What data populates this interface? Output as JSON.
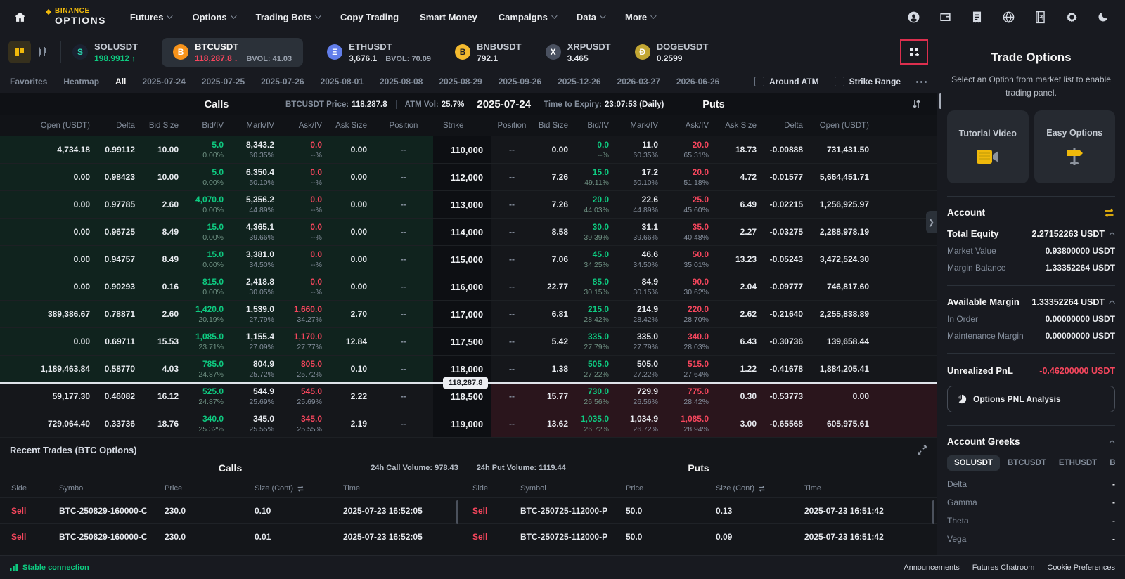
{
  "topnav": {
    "brand_line1": "BINANCE",
    "brand_line2": "OPTIONS",
    "items": [
      {
        "label": "Futures",
        "caret": true
      },
      {
        "label": "Options",
        "caret": true
      },
      {
        "label": "Trading Bots",
        "caret": true
      },
      {
        "label": "Copy Trading",
        "caret": false
      },
      {
        "label": "Smart Money",
        "caret": false
      },
      {
        "label": "Campaigns",
        "caret": true
      },
      {
        "label": "Data",
        "caret": true
      },
      {
        "label": "More",
        "caret": true
      }
    ]
  },
  "ticker_bar": {
    "tickers": [
      {
        "symbol": "SOLUSDT",
        "price": "198.9912",
        "dir": "up",
        "bvol": "",
        "icon_char": "S",
        "icon_bg": "#1b2130",
        "icon_color": "#2bd9b1",
        "selected": false
      },
      {
        "symbol": "BTCUSDT",
        "price": "118,287.8",
        "dir": "down",
        "bvol": "BVOL: 41.03",
        "icon_char": "B",
        "icon_bg": "#f7931a",
        "icon_color": "#ffffff",
        "selected": true
      },
      {
        "symbol": "ETHUSDT",
        "price": "3,676.1",
        "dir": "",
        "bvol": "BVOL: 70.09",
        "icon_char": "Ξ",
        "icon_bg": "#627eea",
        "icon_color": "#ffffff",
        "selected": false
      },
      {
        "symbol": "BNBUSDT",
        "price": "792.1",
        "dir": "",
        "bvol": "",
        "icon_char": "B",
        "icon_bg": "#f3ba2f",
        "icon_color": "#1e2026",
        "selected": false
      },
      {
        "symbol": "XRPUSDT",
        "price": "3.465",
        "dir": "",
        "bvol": "",
        "icon_char": "X",
        "icon_bg": "#4a5160",
        "icon_color": "#ffffff",
        "selected": false
      },
      {
        "symbol": "DOGEUSDT",
        "price": "0.2599",
        "dir": "",
        "bvol": "",
        "icon_char": "Ð",
        "icon_bg": "#c2a633",
        "icon_color": "#ffffff",
        "selected": false
      }
    ]
  },
  "filter_bar": {
    "tabs": [
      {
        "label": "Favorites",
        "active": false
      },
      {
        "label": "Heatmap",
        "active": false
      },
      {
        "label": "All",
        "active": true
      },
      {
        "label": "2025-07-24",
        "active": false
      },
      {
        "label": "2025-07-25",
        "active": false
      },
      {
        "label": "2025-07-26",
        "active": false
      },
      {
        "label": "2025-08-01",
        "active": false
      },
      {
        "label": "2025-08-08",
        "active": false
      },
      {
        "label": "2025-08-29",
        "active": false
      },
      {
        "label": "2025-09-26",
        "active": false
      },
      {
        "label": "2025-12-26",
        "active": false
      },
      {
        "label": "2026-03-27",
        "active": false
      },
      {
        "label": "2026-06-26",
        "active": false
      }
    ],
    "around_atm": "Around ATM",
    "strike_range": "Strike Range"
  },
  "chain": {
    "calls_title": "Calls",
    "puts_title": "Puts",
    "price_label": "BTCUSDT Price:",
    "price_value": "118,287.8",
    "atm_vol_label": "ATM Vol:",
    "atm_vol_value": "25.7%",
    "date": "2025-07-24",
    "expiry_label": "Time to Expiry:",
    "expiry_value": "23:07:53 (Daily)",
    "call_headers": [
      "Open (USDT)",
      "Delta",
      "Bid Size",
      "Bid/IV",
      "Mark/IV",
      "Ask/IV",
      "Ask Size",
      "Position"
    ],
    "strike_header": "Strike",
    "put_headers": [
      "Position",
      "Bid Size",
      "Bid/IV",
      "Mark/IV",
      "Ask/IV",
      "Ask Size",
      "Delta",
      "Open (USDT)"
    ],
    "price_tag": "118,287.8",
    "price_line_row": 9,
    "rows": [
      {
        "strike": "110,000",
        "call": {
          "open": "4,734.18",
          "delta": "0.99112",
          "bid_size": "10.00",
          "bid": "5.0",
          "bid_iv": "0.00%",
          "mark": "8,343.2",
          "mark_iv": "60.35%",
          "ask": "0.0",
          "ask_iv": "--%",
          "ask_size": "0.00",
          "position": "--",
          "itm": true
        },
        "put": {
          "position": "--",
          "bid_size": "0.00",
          "bid": "0.0",
          "bid_iv": "--%",
          "mark": "11.0",
          "mark_iv": "60.35%",
          "ask": "20.0",
          "ask_iv": "65.31%",
          "ask_size": "18.73",
          "delta": "-0.00888",
          "open": "731,431.50",
          "itm": false
        }
      },
      {
        "strike": "112,000",
        "call": {
          "open": "0.00",
          "delta": "0.98423",
          "bid_size": "10.00",
          "bid": "5.0",
          "bid_iv": "0.00%",
          "mark": "6,350.4",
          "mark_iv": "50.10%",
          "ask": "0.0",
          "ask_iv": "--%",
          "ask_size": "0.00",
          "position": "--",
          "itm": true
        },
        "put": {
          "position": "--",
          "bid_size": "7.26",
          "bid": "15.0",
          "bid_iv": "49.11%",
          "mark": "17.2",
          "mark_iv": "50.10%",
          "ask": "20.0",
          "ask_iv": "51.18%",
          "ask_size": "4.72",
          "delta": "-0.01577",
          "open": "5,664,451.71",
          "itm": false
        }
      },
      {
        "strike": "113,000",
        "call": {
          "open": "0.00",
          "delta": "0.97785",
          "bid_size": "2.60",
          "bid": "4,070.0",
          "bid_iv": "0.00%",
          "mark": "5,356.2",
          "mark_iv": "44.89%",
          "ask": "0.0",
          "ask_iv": "--%",
          "ask_size": "0.00",
          "position": "--",
          "itm": true
        },
        "put": {
          "position": "--",
          "bid_size": "7.26",
          "bid": "20.0",
          "bid_iv": "44.03%",
          "mark": "22.6",
          "mark_iv": "44.89%",
          "ask": "25.0",
          "ask_iv": "45.60%",
          "ask_size": "6.49",
          "delta": "-0.02215",
          "open": "1,256,925.97",
          "itm": false
        }
      },
      {
        "strike": "114,000",
        "call": {
          "open": "0.00",
          "delta": "0.96725",
          "bid_size": "8.49",
          "bid": "15.0",
          "bid_iv": "0.00%",
          "mark": "4,365.1",
          "mark_iv": "39.66%",
          "ask": "0.0",
          "ask_iv": "--%",
          "ask_size": "0.00",
          "position": "--",
          "itm": true
        },
        "put": {
          "position": "--",
          "bid_size": "8.58",
          "bid": "30.0",
          "bid_iv": "39.39%",
          "mark": "31.1",
          "mark_iv": "39.66%",
          "ask": "35.0",
          "ask_iv": "40.48%",
          "ask_size": "2.27",
          "delta": "-0.03275",
          "open": "2,288,978.19",
          "itm": false
        }
      },
      {
        "strike": "115,000",
        "call": {
          "open": "0.00",
          "delta": "0.94757",
          "bid_size": "8.49",
          "bid": "15.0",
          "bid_iv": "0.00%",
          "mark": "3,381.0",
          "mark_iv": "34.50%",
          "ask": "0.0",
          "ask_iv": "--%",
          "ask_size": "0.00",
          "position": "--",
          "itm": true
        },
        "put": {
          "position": "--",
          "bid_size": "7.06",
          "bid": "45.0",
          "bid_iv": "34.25%",
          "mark": "46.6",
          "mark_iv": "34.50%",
          "ask": "50.0",
          "ask_iv": "35.01%",
          "ask_size": "13.23",
          "delta": "-0.05243",
          "open": "3,472,524.30",
          "itm": false
        }
      },
      {
        "strike": "116,000",
        "call": {
          "open": "0.00",
          "delta": "0.90293",
          "bid_size": "0.16",
          "bid": "815.0",
          "bid_iv": "0.00%",
          "mark": "2,418.8",
          "mark_iv": "30.05%",
          "ask": "0.0",
          "ask_iv": "--%",
          "ask_size": "0.00",
          "position": "--",
          "itm": true
        },
        "put": {
          "position": "--",
          "bid_size": "22.77",
          "bid": "85.0",
          "bid_iv": "30.15%",
          "mark": "84.9",
          "mark_iv": "30.15%",
          "ask": "90.0",
          "ask_iv": "30.62%",
          "ask_size": "2.04",
          "delta": "-0.09777",
          "open": "746,817.60",
          "itm": false
        }
      },
      {
        "strike": "117,000",
        "call": {
          "open": "389,386.67",
          "delta": "0.78871",
          "bid_size": "2.60",
          "bid": "1,420.0",
          "bid_iv": "20.19%",
          "mark": "1,539.0",
          "mark_iv": "27.79%",
          "ask": "1,660.0",
          "ask_iv": "34.27%",
          "ask_size": "2.70",
          "position": "--",
          "itm": true
        },
        "put": {
          "position": "--",
          "bid_size": "6.81",
          "bid": "215.0",
          "bid_iv": "28.42%",
          "mark": "214.9",
          "mark_iv": "28.42%",
          "ask": "220.0",
          "ask_iv": "28.70%",
          "ask_size": "2.62",
          "delta": "-0.21640",
          "open": "2,255,838.89",
          "itm": false
        }
      },
      {
        "strike": "117,500",
        "call": {
          "open": "0.00",
          "delta": "0.69711",
          "bid_size": "15.53",
          "bid": "1,085.0",
          "bid_iv": "23.71%",
          "mark": "1,155.4",
          "mark_iv": "27.09%",
          "ask": "1,170.0",
          "ask_iv": "27.77%",
          "ask_size": "12.84",
          "position": "--",
          "itm": true
        },
        "put": {
          "position": "--",
          "bid_size": "5.42",
          "bid": "335.0",
          "bid_iv": "27.79%",
          "mark": "335.0",
          "mark_iv": "27.79%",
          "ask": "340.0",
          "ask_iv": "28.03%",
          "ask_size": "6.43",
          "delta": "-0.30736",
          "open": "139,658.44",
          "itm": false
        }
      },
      {
        "strike": "118,000",
        "call": {
          "open": "1,189,463.84",
          "delta": "0.58770",
          "bid_size": "4.03",
          "bid": "785.0",
          "bid_iv": "24.87%",
          "mark": "804.9",
          "mark_iv": "25.72%",
          "ask": "805.0",
          "ask_iv": "25.72%",
          "ask_size": "0.10",
          "position": "--",
          "itm": true
        },
        "put": {
          "position": "--",
          "bid_size": "1.38",
          "bid": "505.0",
          "bid_iv": "27.22%",
          "mark": "505.0",
          "mark_iv": "27.22%",
          "ask": "515.0",
          "ask_iv": "27.64%",
          "ask_size": "1.22",
          "delta": "-0.41678",
          "open": "1,884,205.41",
          "itm": false
        }
      },
      {
        "strike": "118,500",
        "call": {
          "open": "59,177.30",
          "delta": "0.46082",
          "bid_size": "16.12",
          "bid": "525.0",
          "bid_iv": "24.87%",
          "mark": "544.9",
          "mark_iv": "25.69%",
          "ask": "545.0",
          "ask_iv": "25.69%",
          "ask_size": "2.22",
          "position": "--",
          "itm": false
        },
        "put": {
          "position": "--",
          "bid_size": "15.77",
          "bid": "730.0",
          "bid_iv": "26.56%",
          "mark": "729.9",
          "mark_iv": "26.56%",
          "ask": "775.0",
          "ask_iv": "28.42%",
          "ask_size": "0.30",
          "delta": "-0.53773",
          "open": "0.00",
          "itm": true
        }
      },
      {
        "strike": "119,000",
        "call": {
          "open": "729,064.40",
          "delta": "0.33736",
          "bid_size": "18.76",
          "bid": "340.0",
          "bid_iv": "25.32%",
          "mark": "345.0",
          "mark_iv": "25.55%",
          "ask": "345.0",
          "ask_iv": "25.55%",
          "ask_size": "2.19",
          "position": "--",
          "itm": false
        },
        "put": {
          "position": "--",
          "bid_size": "13.62",
          "bid": "1,035.0",
          "bid_iv": "26.72%",
          "mark": "1,034.9",
          "mark_iv": "26.72%",
          "ask": "1,085.0",
          "ask_iv": "28.94%",
          "ask_size": "3.00",
          "delta": "-0.65568",
          "open": "605,975.61",
          "itm": true
        }
      }
    ]
  },
  "recent_trades": {
    "title": "Recent Trades (BTC Options)",
    "calls_title": "Calls",
    "puts_title": "Puts",
    "call_volume": "24h Call Volume: 978.43",
    "put_volume": "24h Put Volume: 1119.44",
    "headers": [
      "Side",
      "Symbol",
      "Price",
      "Size (Cont)",
      "Time"
    ],
    "calls": [
      {
        "side": "Sell",
        "symbol": "BTC-250829-160000-C",
        "price": "230.0",
        "size": "0.10",
        "time": "2025-07-23 16:52:05"
      },
      {
        "side": "Sell",
        "symbol": "BTC-250829-160000-C",
        "price": "230.0",
        "size": "0.01",
        "time": "2025-07-23 16:52:05"
      }
    ],
    "puts": [
      {
        "side": "Sell",
        "symbol": "BTC-250725-112000-P",
        "price": "50.0",
        "size": "0.13",
        "time": "2025-07-23 16:51:42"
      },
      {
        "side": "Sell",
        "symbol": "BTC-250725-112000-P",
        "price": "50.0",
        "size": "0.09",
        "time": "2025-07-23 16:51:42"
      }
    ]
  },
  "panel": {
    "title": "Trade Options",
    "subtitle": "Select an Option from market list to enable trading panel.",
    "cards": [
      {
        "label": "Tutorial Video"
      },
      {
        "label": "Easy Options"
      }
    ],
    "account": {
      "title": "Account",
      "groups": [
        {
          "label": "Total Equity",
          "value": "2.27152263 USDT",
          "subs": [
            {
              "label": "Market Value",
              "value": "0.93800000 USDT"
            },
            {
              "label": "Margin Balance",
              "value": "1.33352264 USDT"
            }
          ]
        },
        {
          "label": "Available Margin",
          "value": "1.33352264 USDT",
          "subs": [
            {
              "label": "In Order",
              "value": "0.00000000 USDT"
            },
            {
              "label": "Maintenance Margin",
              "value": "0.00000000 USDT"
            }
          ]
        }
      ],
      "pnl_label": "Unrealized PnL",
      "pnl_value": "-0.46200000 USDT",
      "pnl_button": "Options PNL Analysis"
    },
    "greeks": {
      "title": "Account Greeks",
      "tabs": [
        {
          "label": "SOLUSDT",
          "active": true
        },
        {
          "label": "BTCUSDT",
          "active": false
        },
        {
          "label": "ETHUSDT",
          "active": false
        },
        {
          "label": "BNBUSDT",
          "active": false
        }
      ],
      "rows": [
        {
          "label": "Delta",
          "value": "-"
        },
        {
          "label": "Gamma",
          "value": "-"
        },
        {
          "label": "Theta",
          "value": "-"
        },
        {
          "label": "Vega",
          "value": "-"
        }
      ]
    }
  },
  "bottom_bar": {
    "status": "Stable connection",
    "links": [
      "Announcements",
      "Futures Chatroom",
      "Cookie Preferences"
    ]
  }
}
